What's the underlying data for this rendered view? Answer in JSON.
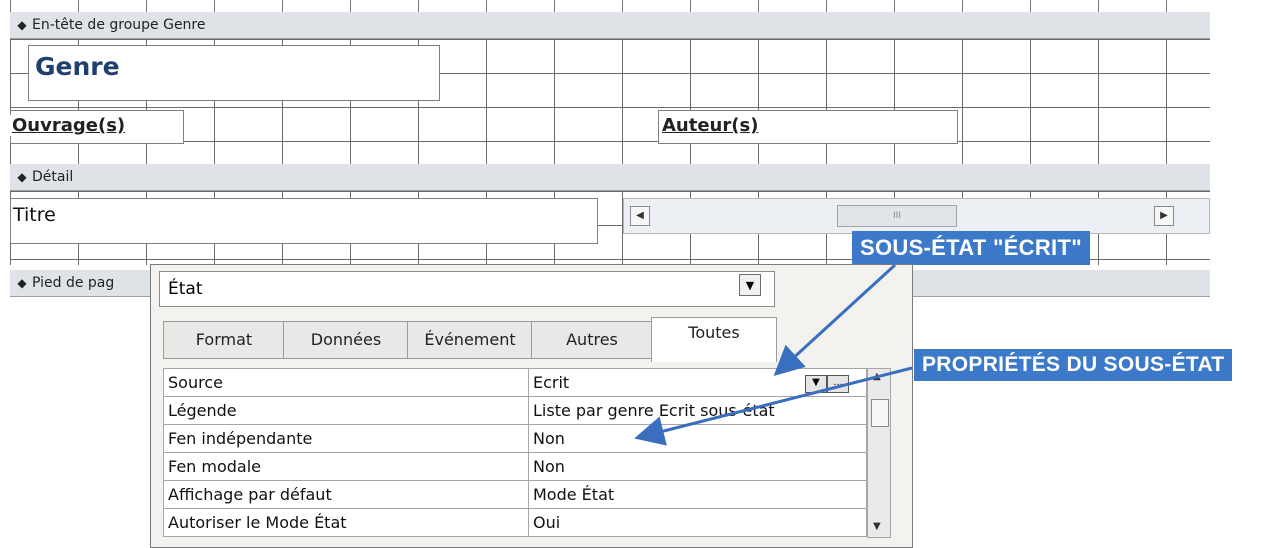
{
  "design": {
    "group_header_band": {
      "arrow": "◆",
      "label": "En-tête de groupe Genre"
    },
    "genre_label": "Genre",
    "ouvrages_label": "Ouvrage(s)",
    "auteurs_label": "Auteur(s)",
    "detail_band": {
      "arrow": "◆",
      "label": "Détail"
    },
    "titre_field": "Titre",
    "page_footer_band": {
      "arrow": "◆",
      "label": "Pied de pag"
    },
    "subreport_scroll": {
      "left_arrow": "◀",
      "right_arrow": "▶",
      "thumb_grip": "III"
    }
  },
  "property_sheet": {
    "object_selector": {
      "value": "État",
      "dropdown_icon": "▼"
    },
    "tabs": [
      {
        "label": "Format",
        "active": false
      },
      {
        "label": "Données",
        "active": false
      },
      {
        "label": "Événement",
        "active": false
      },
      {
        "label": "Autres",
        "active": false
      },
      {
        "label": "Toutes",
        "active": true
      }
    ],
    "rows": [
      {
        "name": "Source",
        "value": "Ecrit"
      },
      {
        "name": "Légende",
        "value": "Liste par genre Ecrit sous-état"
      },
      {
        "name": "Fen indépendante",
        "value": "Non"
      },
      {
        "name": "Fen modale",
        "value": "Non"
      },
      {
        "name": "Affichage par défaut",
        "value": "Mode État"
      },
      {
        "name": "Autoriser le Mode État",
        "value": "Oui"
      }
    ],
    "source_buttons": {
      "dropdown": "▼",
      "builder": "..."
    },
    "scroll": {
      "up": "▲",
      "down": "▼"
    }
  },
  "annotations": {
    "subreport_callout": "SOUS-ÉTAT \"ÉCRIT\"",
    "properties_callout": "PROPRIÉTÉS DU SOUS-ÉTAT",
    "arrow_color": "#3a6fc0"
  }
}
